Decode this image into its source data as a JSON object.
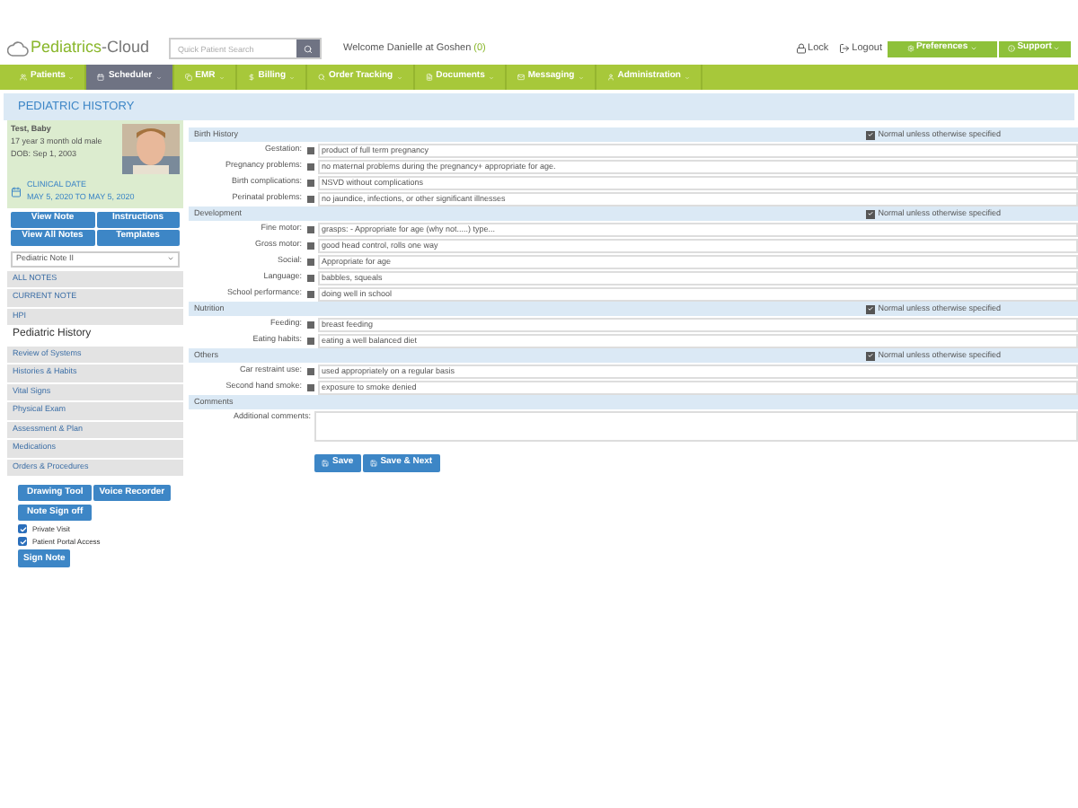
{
  "header": {
    "logo_a": "Pediatrics",
    "logo_b": "-Cloud",
    "search_placeholder": "Quick Patient Search",
    "welcome": "Welcome Danielle at Goshen",
    "welcome_count": "(0)",
    "links": [
      "Lock",
      "Logout"
    ],
    "menus": [
      "Preferences",
      "Support"
    ]
  },
  "nav": [
    {
      "label": "Patients",
      "selected": false
    },
    {
      "label": "Scheduler",
      "selected": true
    },
    {
      "label": "EMR",
      "selected": false
    },
    {
      "label": "Billing",
      "selected": false
    },
    {
      "label": "Order Tracking",
      "selected": false
    },
    {
      "label": "Documents",
      "selected": false
    },
    {
      "label": "Messaging",
      "selected": false
    },
    {
      "label": "Administration",
      "selected": false
    }
  ],
  "page_title": "PEDIATRIC HISTORY",
  "patient": {
    "name": "Test, Baby",
    "age": "17 year 3 month old male",
    "dob": "DOB: Sep 1, 2003",
    "clinical_label": "CLINICAL DATE",
    "clinical_range": "MAY 5, 2020 TO MAY 5, 2020"
  },
  "sidebar_buttons": [
    "View Note",
    "Instructions",
    "View All Notes",
    "Templates"
  ],
  "note_select": "Pediatric Note II",
  "sidebar_items": [
    {
      "label": "ALL NOTES",
      "selected": false
    },
    {
      "label": "CURRENT NOTE",
      "selected": false
    },
    {
      "label": "HPI",
      "selected": false
    },
    {
      "label": "Pediatric History",
      "selected": true
    },
    {
      "label": "Review of Systems",
      "selected": false
    },
    {
      "label": "Histories & Habits",
      "selected": false
    },
    {
      "label": "Vital Signs",
      "selected": false
    },
    {
      "label": "Physical Exam",
      "selected": false
    },
    {
      "label": "Assessment & Plan",
      "selected": false
    },
    {
      "label": "Medications",
      "selected": false
    },
    {
      "label": "Orders & Procedures",
      "selected": false
    }
  ],
  "tool_buttons": [
    "Drawing Tool",
    "Voice Recorder",
    "Note Sign off"
  ],
  "options": [
    {
      "label": "Private Visit",
      "checked": true
    },
    {
      "label": "Patient Portal Access",
      "checked": true
    }
  ],
  "sign_button": "Sign Note",
  "sections": [
    {
      "title": "Birth History",
      "normal": {
        "label": "Normal unless otherwise specified",
        "checked": true
      },
      "fields": [
        {
          "label": "Gestation:",
          "value": "product of full term pregnancy"
        },
        {
          "label": "Pregnancy problems:",
          "value": "no maternal problems during the pregnancy+ appropriate for age."
        },
        {
          "label": "Birth complications:",
          "value": "NSVD without complications"
        },
        {
          "label": "Perinatal problems:",
          "value": "no jaundice, infections, or other significant illnesses"
        }
      ]
    },
    {
      "title": "Development",
      "normal": {
        "label": "Normal unless otherwise specified",
        "checked": true
      },
      "fields": [
        {
          "label": "Fine motor:",
          "value": "grasps: - Appropriate for age (why not.....) type..."
        },
        {
          "label": "Gross motor:",
          "value": "good head control, rolls one way"
        },
        {
          "label": "Social:",
          "value": "Appropriate for age"
        },
        {
          "label": "Language:",
          "value": "babbles, squeals"
        },
        {
          "label": "School performance:",
          "value": "doing well in school"
        }
      ]
    },
    {
      "title": "Nutrition",
      "normal": {
        "label": "Normal unless otherwise specified",
        "checked": true
      },
      "fields": [
        {
          "label": "Feeding:",
          "value": "breast feeding"
        },
        {
          "label": "Eating habits:",
          "value": "eating a well balanced diet"
        }
      ]
    },
    {
      "title": "Others",
      "normal": {
        "label": "Normal unless otherwise specified",
        "checked": true
      },
      "fields": [
        {
          "label": "Car restraint use:",
          "value": "used appropriately on a regular basis"
        },
        {
          "label": "Second hand smoke:",
          "value": "exposure to smoke denied"
        }
      ]
    },
    {
      "title": "Comments",
      "comment_label": "Additional comments:"
    }
  ],
  "actions": [
    "Save",
    "Save & Next"
  ]
}
